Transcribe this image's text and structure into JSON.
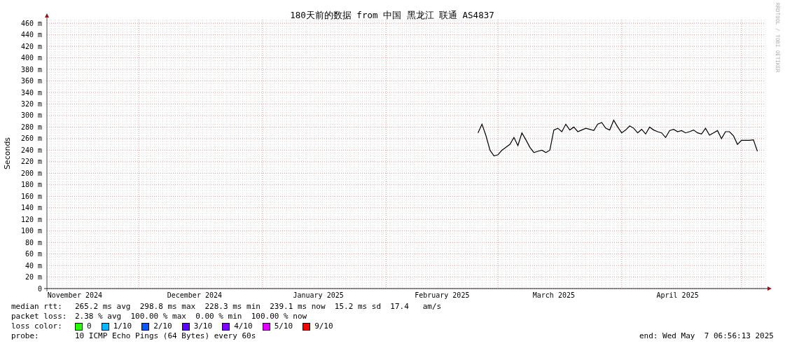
{
  "graph": {
    "chart_data": {
      "type": "line",
      "title": "180天前的数据 from 中国 黑龙江 联通 AS4837",
      "ylabel": "Seconds",
      "categories": [
        null,
        null,
        null,
        null,
        null,
        null,
        null,
        "November 2024",
        null,
        null,
        null,
        null,
        null,
        null,
        null,
        null,
        null,
        null,
        null,
        null,
        null,
        null,
        null,
        null,
        null,
        null,
        null,
        null,
        null,
        null,
        null,
        null,
        null,
        null,
        null,
        null,
        null,
        "December 2024",
        null,
        null,
        null,
        null,
        null,
        null,
        null,
        null,
        null,
        null,
        null,
        null,
        null,
        null,
        null,
        null,
        null,
        null,
        null,
        null,
        null,
        null,
        null,
        null,
        null,
        null,
        null,
        null,
        null,
        null,
        "January 2025",
        null,
        null,
        null,
        null,
        null,
        null,
        null,
        null,
        null,
        null,
        null,
        null,
        null,
        null,
        null,
        null,
        null,
        null,
        null,
        null,
        null,
        null,
        null,
        null,
        null,
        null,
        null,
        null,
        null,
        null,
        "February 2025",
        null,
        null,
        null,
        null,
        null,
        null,
        null,
        null,
        null,
        null,
        null,
        null,
        null,
        null,
        null,
        null,
        null,
        null,
        null,
        null,
        null,
        null,
        null,
        null,
        null,
        null,
        null,
        "March 2025",
        null,
        null,
        null,
        null,
        null,
        null,
        null,
        null,
        null,
        null,
        null,
        null,
        null,
        null,
        null,
        null,
        null,
        null,
        null,
        null,
        null,
        null,
        null,
        null,
        null,
        null,
        null,
        null,
        null,
        null,
        "April 2025",
        null,
        null,
        null,
        null,
        null,
        null,
        null,
        null,
        null,
        null,
        null,
        null,
        null,
        null,
        null,
        null,
        null,
        null,
        null,
        null,
        null,
        null
      ],
      "grid": true,
      "series": [
        {
          "color": "#000000",
          "values": [
            null,
            null,
            null,
            null,
            null,
            null,
            null,
            null,
            null,
            null,
            null,
            null,
            null,
            null,
            null,
            null,
            null,
            null,
            null,
            null,
            null,
            null,
            null,
            null,
            null,
            null,
            null,
            null,
            null,
            null,
            null,
            null,
            null,
            null,
            null,
            null,
            null,
            null,
            null,
            null,
            null,
            null,
            null,
            null,
            null,
            null,
            null,
            null,
            null,
            null,
            null,
            null,
            null,
            null,
            null,
            null,
            null,
            null,
            null,
            null,
            null,
            null,
            null,
            null,
            null,
            null,
            null,
            null,
            null,
            null,
            null,
            null,
            null,
            null,
            null,
            null,
            null,
            null,
            null,
            null,
            null,
            null,
            null,
            null,
            null,
            null,
            null,
            null,
            null,
            null,
            null,
            null,
            null,
            null,
            null,
            null,
            null,
            null,
            null,
            null,
            null,
            null,
            null,
            null,
            null,
            null,
            null,
            null,
            270,
            285,
            265,
            240,
            230,
            232,
            240,
            245,
            250,
            262,
            248,
            270,
            258,
            245,
            236,
            238,
            240,
            236,
            240,
            275,
            278,
            272,
            285,
            275,
            280,
            272,
            275,
            278,
            276,
            274,
            285,
            288,
            278,
            275,
            292,
            280,
            270,
            275,
            282,
            278,
            270,
            276,
            268,
            280,
            275,
            272,
            270,
            262,
            274,
            276,
            272,
            274,
            270,
            272,
            275,
            270,
            268,
            278,
            266,
            270,
            274,
            260,
            272,
            272,
            265,
            250,
            257,
            257,
            257,
            258,
            238,
            null,
            null
          ]
        }
      ],
      "ylim": [
        0,
        470
      ],
      "yticks": [
        {
          "value": 0,
          "label": "0"
        },
        {
          "value": 20,
          "label": "20 m"
        },
        {
          "value": 40,
          "label": "40 m"
        },
        {
          "value": 60,
          "label": "60 m"
        },
        {
          "value": 80,
          "label": "80 m"
        },
        {
          "value": 100,
          "label": "100 m"
        },
        {
          "value": 120,
          "label": "120 m"
        },
        {
          "value": 140,
          "label": "140 m"
        },
        {
          "value": 160,
          "label": "160 m"
        },
        {
          "value": 180,
          "label": "180 m"
        },
        {
          "value": 200,
          "label": "200 m"
        },
        {
          "value": 220,
          "label": "220 m"
        },
        {
          "value": 240,
          "label": "240 m"
        },
        {
          "value": 260,
          "label": "260 m"
        },
        {
          "value": 280,
          "label": "280 m"
        },
        {
          "value": 300,
          "label": "300 m"
        },
        {
          "value": 320,
          "label": "320 m"
        },
        {
          "value": 340,
          "label": "340 m"
        },
        {
          "value": 360,
          "label": "360 m"
        },
        {
          "value": 380,
          "label": "380 m"
        },
        {
          "value": 400,
          "label": "400 m"
        },
        {
          "value": 420,
          "label": "420 m"
        },
        {
          "value": 440,
          "label": "440 m"
        },
        {
          "value": 460,
          "label": "460 m"
        }
      ]
    },
    "credit": "RRDTOOL / TOBI OETIKER"
  },
  "stats": [
    {
      "label": "median rtt:",
      "value": "265.2 ms avg  298.8 ms max  228.3 ms min  239.1 ms now  15.2 ms sd  17.4   am/s"
    },
    {
      "label": "packet loss:",
      "value": "2.38 % avg  100.00 % max  0.00 % min  100.00 % now"
    }
  ],
  "loss_legend": {
    "label": "loss color:",
    "items": [
      {
        "label": "0",
        "color": "#26ff00"
      },
      {
        "label": "1/10",
        "color": "#00b8ff"
      },
      {
        "label": "2/10",
        "color": "#0059ff"
      },
      {
        "label": "3/10",
        "color": "#5e00ff"
      },
      {
        "label": "4/10",
        "color": "#7e00ff"
      },
      {
        "label": "5/10",
        "color": "#dd00ff"
      },
      {
        "label": "9/10",
        "color": "#ff0000"
      }
    ]
  },
  "probe": {
    "label": "probe:",
    "value": "10 ICMP Echo Pings (64 Bytes) every 60s"
  },
  "end_time": "end: Wed May  7 06:56:13 2025"
}
